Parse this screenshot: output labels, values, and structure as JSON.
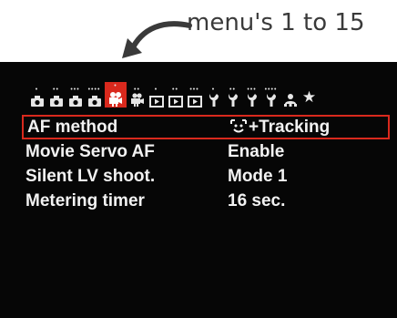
{
  "annotation": {
    "text": "menu's 1 to 15",
    "arrow_icon": "curved-arrow-icon"
  },
  "colors": {
    "accent": "#d9291d",
    "screen_bg": "#060606",
    "text": "#f2f2f2"
  },
  "tabs": [
    {
      "icon": "camera-shoot-icon",
      "dots": "•"
    },
    {
      "icon": "camera-shoot-icon",
      "dots": "••"
    },
    {
      "icon": "camera-shoot-icon",
      "dots": "•••"
    },
    {
      "icon": "camera-shoot-icon",
      "dots": "••••"
    },
    {
      "icon": "movie-camera-icon",
      "dots": "•",
      "active": true
    },
    {
      "icon": "movie-camera-icon",
      "dots": "••"
    },
    {
      "icon": "playback-icon",
      "dots": "•"
    },
    {
      "icon": "playback-icon",
      "dots": "••"
    },
    {
      "icon": "playback-icon",
      "dots": "•••"
    },
    {
      "icon": "wrench-icon",
      "dots": "•"
    },
    {
      "icon": "wrench-icon",
      "dots": "••"
    },
    {
      "icon": "wrench-icon",
      "dots": "•••"
    },
    {
      "icon": "wrench-icon",
      "dots": "••••"
    },
    {
      "icon": "custom-function-icon",
      "dots": ""
    },
    {
      "icon": "my-menu-star-icon",
      "dots": ""
    }
  ],
  "menu": {
    "items": [
      {
        "label": "AF method",
        "value": "+Tracking",
        "value_icon": "face-detection-icon",
        "selected": true
      },
      {
        "label": "Movie Servo AF",
        "value": "Enable"
      },
      {
        "label": "Silent LV shoot.",
        "value": "Mode 1"
      },
      {
        "label": "Metering timer",
        "value": "16 sec."
      }
    ]
  }
}
